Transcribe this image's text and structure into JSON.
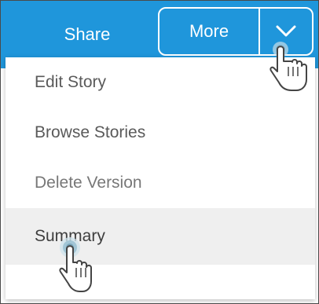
{
  "toolbar": {
    "share_label": "Share",
    "more_label": "More",
    "accent_color": "#1f96db"
  },
  "menu": {
    "items": [
      {
        "label": "Edit Story"
      },
      {
        "label": "Browse Stories"
      },
      {
        "label": "Delete Version"
      },
      {
        "label": "Summary"
      }
    ],
    "highlighted": "Summary"
  },
  "icons": {
    "dropdown": "chevron-down-icon",
    "cursor": "hand-pointer-icon"
  }
}
